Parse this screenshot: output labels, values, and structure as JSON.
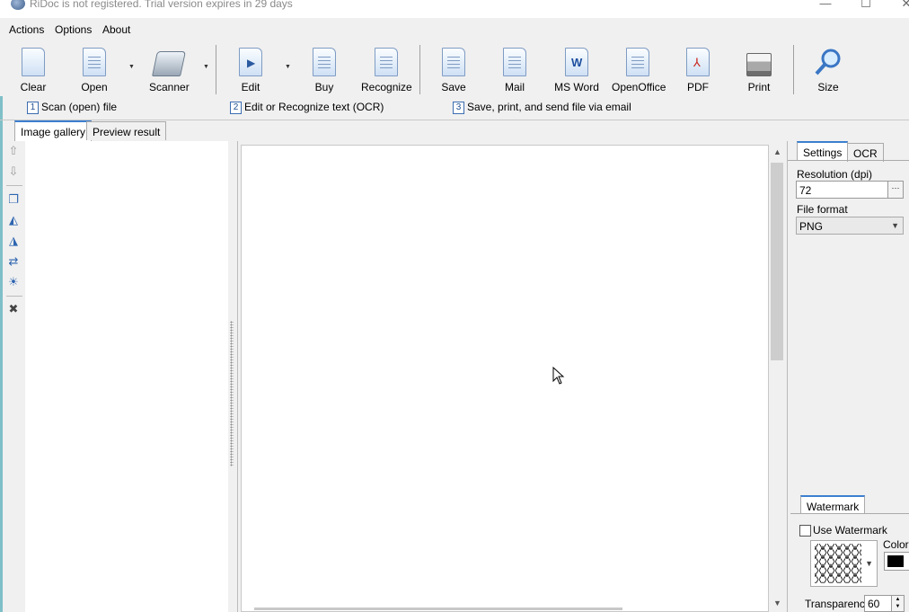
{
  "window": {
    "title": "RiDoc is not registered. Trial version expires in 29 days",
    "controls": {
      "minimize": "—",
      "maximize": "☐",
      "close": "✕"
    }
  },
  "menu": {
    "items": [
      "Actions",
      "Options",
      "About"
    ]
  },
  "toolbar": {
    "buttons": [
      {
        "label": "Clear",
        "icon": "blank-document-icon"
      },
      {
        "label": "Open",
        "icon": "open-document-icon"
      },
      {
        "label": "Scanner",
        "icon": "scanner-icon"
      },
      {
        "label": "Edit",
        "icon": "edit-document-icon"
      },
      {
        "label": "Buy",
        "icon": "buy-icon"
      },
      {
        "label": "Recognize",
        "icon": "recognize-icon"
      },
      {
        "label": "Save",
        "icon": "save-icon"
      },
      {
        "label": "Mail",
        "icon": "mail-icon"
      },
      {
        "label": "MS Word",
        "icon": "word-icon"
      },
      {
        "label": "OpenOffice",
        "icon": "openoffice-icon"
      },
      {
        "label": "PDF",
        "icon": "pdf-icon"
      },
      {
        "label": "Print",
        "icon": "printer-icon"
      },
      {
        "label": "Size",
        "icon": "magnifier-icon"
      }
    ],
    "dropdown_glyph": "▼"
  },
  "steps": [
    {
      "num": "1",
      "label": "Scan (open) file"
    },
    {
      "num": "2",
      "label": "Edit or Recognize text (OCR)"
    },
    {
      "num": "3",
      "label": "Save, print, and send file via email"
    }
  ],
  "tabs": {
    "gallery": "Image gallery",
    "preview": "Preview result"
  },
  "side_tools": [
    {
      "icon": "arrow-up-icon",
      "glyph": "⇧"
    },
    {
      "icon": "arrow-down-icon",
      "glyph": "⇩"
    },
    {
      "icon": "copy-pages-icon",
      "glyph": "❐"
    },
    {
      "icon": "rotate-left-icon",
      "glyph": "◭"
    },
    {
      "icon": "rotate-right-icon",
      "glyph": "◮"
    },
    {
      "icon": "flip-icon",
      "glyph": "⇄"
    },
    {
      "icon": "brightness-icon",
      "glyph": "☀"
    },
    {
      "icon": "tools-icon",
      "glyph": "✖"
    }
  ],
  "settings": {
    "tabs": {
      "settings": "Settings",
      "ocr": "OCR"
    },
    "resolution_label": "Resolution (dpi)",
    "resolution_value": "72",
    "browse": "···",
    "format_label": "File format",
    "format_value": "PNG",
    "watermark_tab": "Watermark",
    "use_watermark": "Use Watermark",
    "use_watermark_checked": false,
    "color_label": "Color",
    "color_value": "#000000",
    "transparency_label": "Transparency",
    "transparency_value": "60"
  },
  "scroll": {
    "up": "▲",
    "down": "▼"
  }
}
